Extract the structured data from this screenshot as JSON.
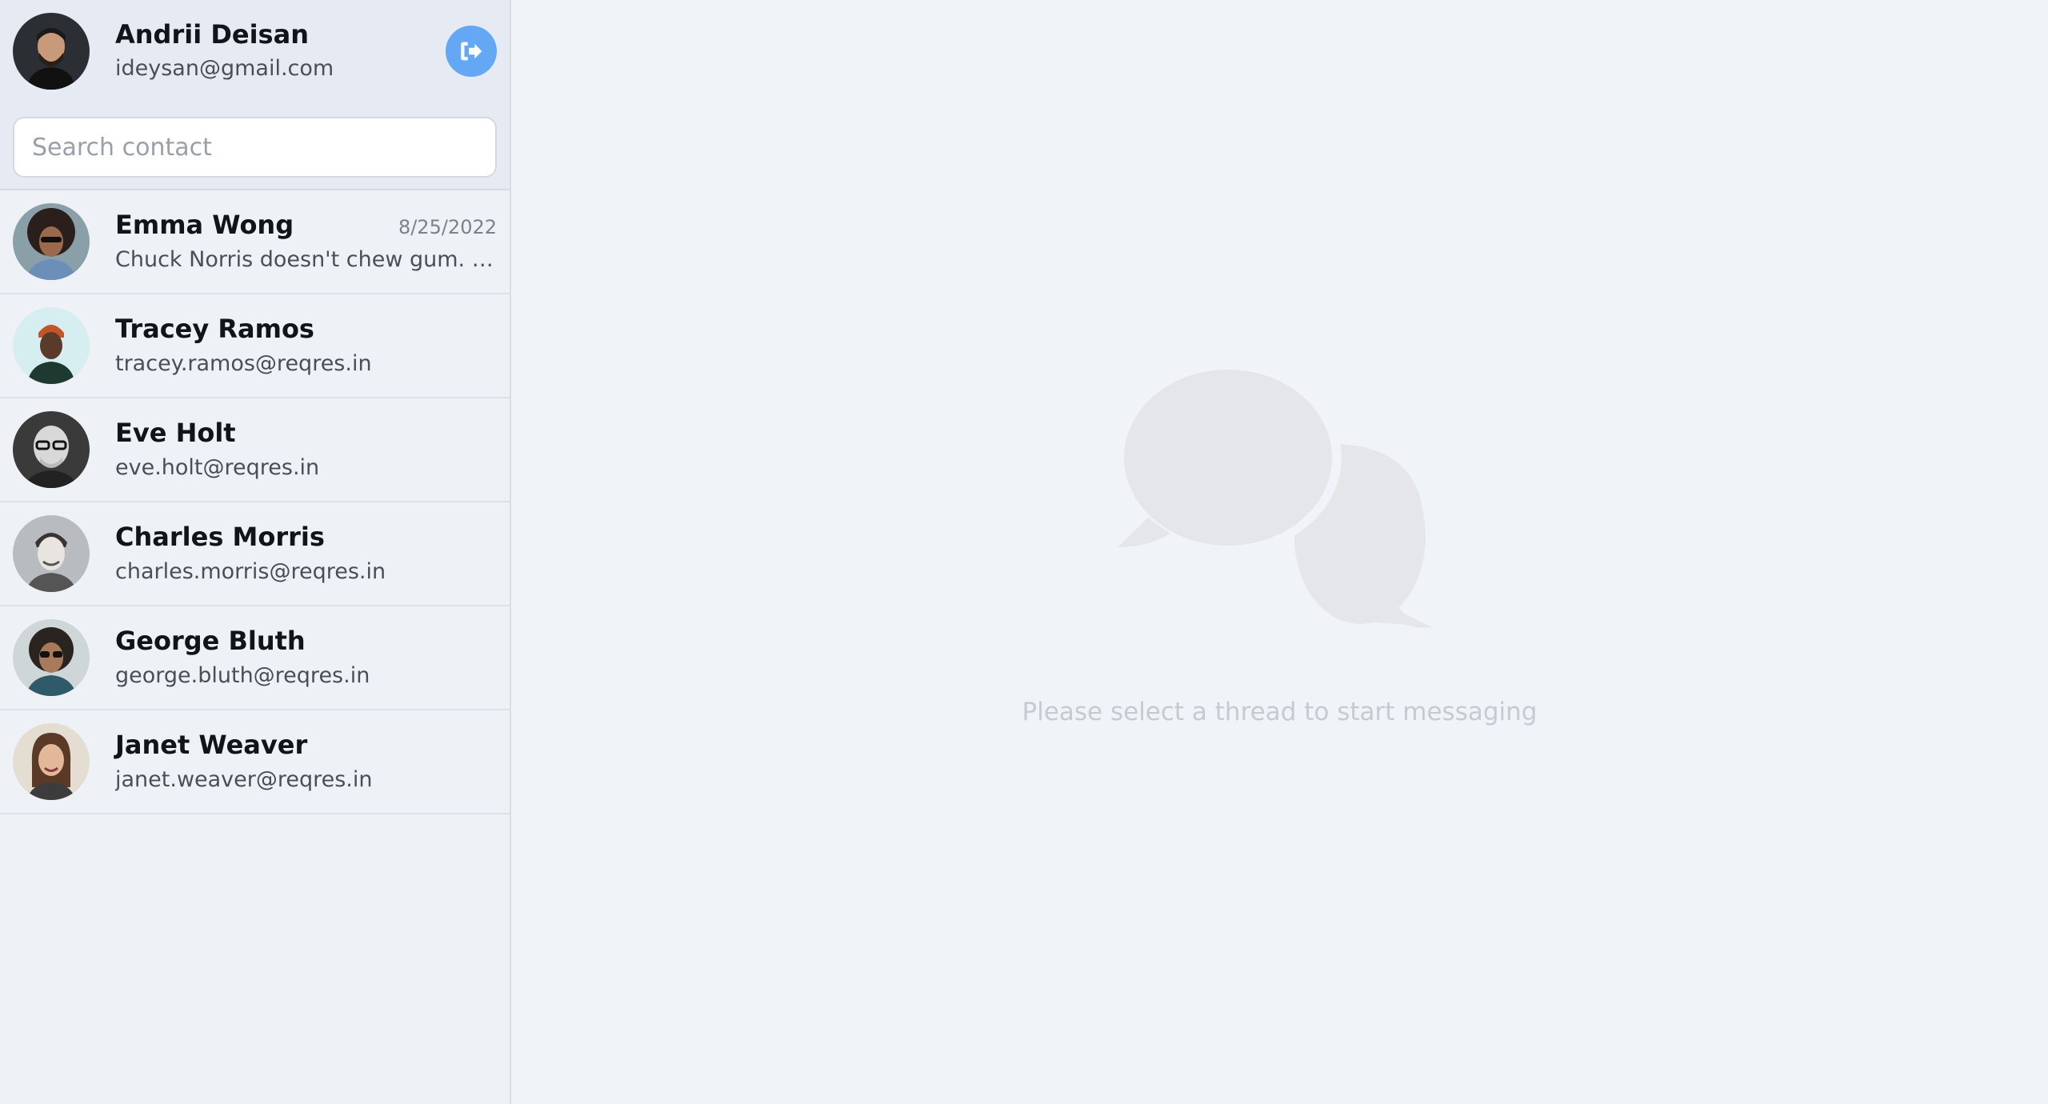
{
  "profile": {
    "name": "Andrii Deisan",
    "email": "ideysan@gmail.com",
    "avatar_icon": "user-avatar"
  },
  "search": {
    "placeholder": "Search contact",
    "value": ""
  },
  "contacts": [
    {
      "name": "Emma Wong",
      "subtitle": "Chuck Norris doesn't chew gum. Ch...",
      "date": "8/25/2022"
    },
    {
      "name": "Tracey Ramos",
      "subtitle": "tracey.ramos@reqres.in",
      "date": ""
    },
    {
      "name": "Eve Holt",
      "subtitle": "eve.holt@reqres.in",
      "date": ""
    },
    {
      "name": "Charles Morris",
      "subtitle": "charles.morris@reqres.in",
      "date": ""
    },
    {
      "name": "George Bluth",
      "subtitle": "george.bluth@reqres.in",
      "date": ""
    },
    {
      "name": "Janet Weaver",
      "subtitle": "janet.weaver@reqres.in",
      "date": ""
    }
  ],
  "main": {
    "empty_message": "Please select a thread to start messaging",
    "empty_icon": "chat-bubbles-icon"
  },
  "colors": {
    "accent": "#63a7f5",
    "sidebar_bg": "#eef1f6",
    "main_bg": "#f0f3f8"
  }
}
